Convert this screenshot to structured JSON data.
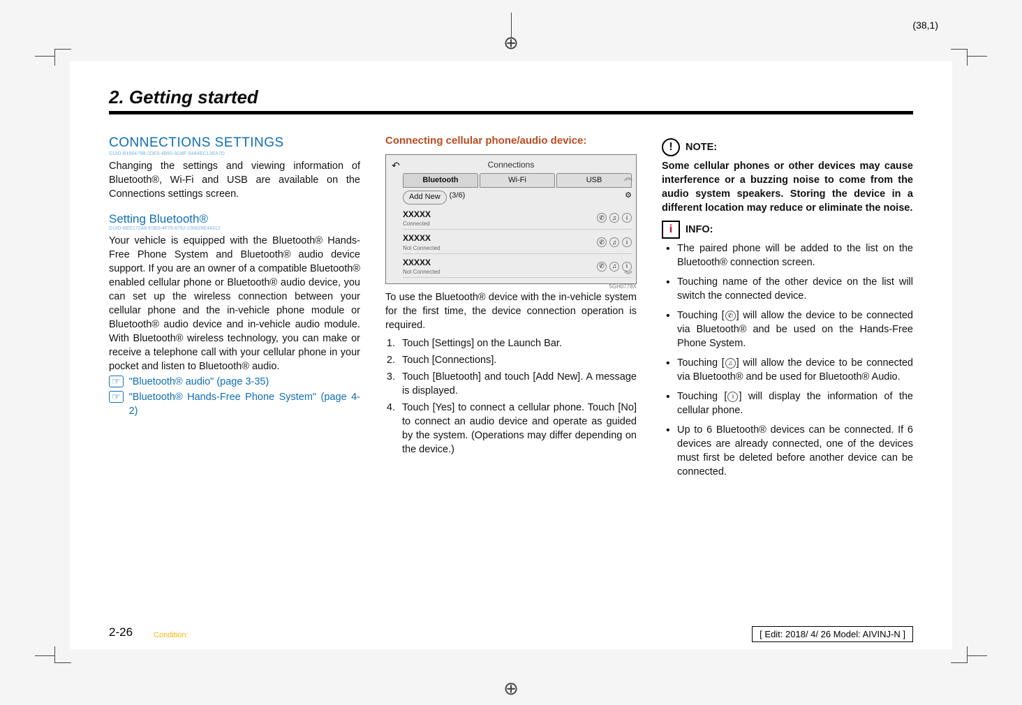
{
  "page_marker": "(38,1)",
  "chapter": "2. Getting started",
  "col1": {
    "h1": "CONNECTIONS SETTINGS",
    "guid1": "GUID-B106479B-2DE5-4B50-AD8F-54A4EC13EA7D",
    "p1": "Changing the settings and viewing information of Bluetooth®, Wi-Fi and USB are available on the Connections settings screen.",
    "h2": "Setting Bluetooth®",
    "guid2": "GUID-BEE172A8-E0E0-4F75-8762-230628E44312",
    "p2": "Your vehicle is equipped with the Bluetooth® Hands-Free Phone System and Bluetooth® audio device support. If you are an owner of a compatible Bluetooth® enabled cellular phone or Bluetooth® audio device, you can set up the wireless connection between your cellular phone and the in-vehicle phone module or Bluetooth® audio device and in-vehicle audio module. With Bluetooth® wireless technology, you can make or receive a telephone call with your cellular phone in your pocket and listen to Bluetooth® audio.",
    "ref1": "\"Bluetooth® audio\" (page 3-35)",
    "ref2": "\"Bluetooth® Hands-Free Phone System\" (page 4-2)"
  },
  "col2": {
    "h_arrow": "Connecting cellular phone/audio device:",
    "fig": {
      "title": "Connections",
      "tab1": "Bluetooth",
      "tab2": "Wi-Fi",
      "tab3": "USB",
      "add": "Add New",
      "count": "(3/6)",
      "row_name": "XXXXX",
      "row1_status": "Connected",
      "row2_status": "Not Connected",
      "row3_status": "Not Connected",
      "id": "5GH0778X"
    },
    "p1": "To use the Bluetooth® device with the in-vehicle system for the first time, the device connection operation is required.",
    "step1": "Touch [Settings] on the Launch Bar.",
    "step2": "Touch [Connections].",
    "step3": "Touch [Bluetooth] and touch [Add New]. A message is displayed.",
    "step4": "Touch [Yes] to connect a cellular phone. Touch [No] to connect an audio device and operate as guided by the system. (Operations may differ depending on the device.)"
  },
  "col3": {
    "note_label": "NOTE:",
    "note_body": "Some cellular phones or other devices may cause interference or a buzzing noise to come from the audio system speakers. Storing the device in a different location may reduce or eliminate the noise.",
    "info_label": "INFO:",
    "i1": "The paired phone will be added to the list on the Bluetooth® connection screen.",
    "i2": "Touching name of the other device on the list will switch the connected device.",
    "i3a": "Touching [",
    "i3b": "] will allow the device to be connected via Bluetooth® and be used on the Hands-Free Phone System.",
    "i4a": "Touching [",
    "i4b": "] will allow the device to be connected via Bluetooth® and be used for Bluetooth® Audio.",
    "i5a": "Touching [",
    "i5b": "] will display the information of the cellular phone.",
    "i6": "Up to 6 Bluetooth® devices can be connected. If 6 devices are already connected, one of the devices must first be deleted before another device can be connected."
  },
  "page_num": "2-26",
  "condition": "Condition:",
  "edit_box": "[ Edit: 2018/ 4/ 26   Model:  AIVINJ-N ]"
}
